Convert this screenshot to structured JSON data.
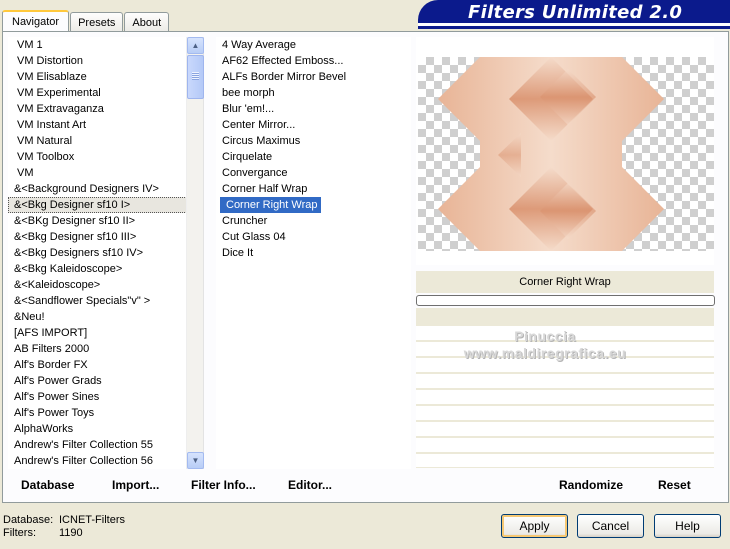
{
  "tabs": [
    "Navigator",
    "Presets",
    "About"
  ],
  "active_tab": "Navigator",
  "banner_title": "Filters Unlimited 2.0",
  "categories": [
    "VM 1",
    "VM Distortion",
    "VM Elisablaze",
    "VM Experimental",
    "VM Extravaganza",
    "VM Instant Art",
    "VM Natural",
    "VM Toolbox",
    "VM",
    "&<Background Designers IV>",
    "&<Bkg Designer sf10 I>",
    "&<BKg Designer sf10 II>",
    "&<Bkg Designer sf10 III>",
    "&<Bkg Designers sf10 IV>",
    "&<Bkg Kaleidoscope>",
    "&<Kaleidoscope>",
    "&<Sandflower Specials\"v\" >",
    "&Neu!",
    "[AFS IMPORT]",
    "AB Filters 2000",
    "Alf's Border FX",
    "Alf's Power Grads",
    "Alf's Power Sines",
    "Alf's Power Toys",
    "AlphaWorks",
    "Andrew's Filter Collection 55",
    "Andrew's Filter Collection 56"
  ],
  "selected_category": "&<Bkg Designer sf10 I>",
  "filters": [
    "4 Way Average",
    "AF62 Effected Emboss...",
    "ALFs Border Mirror Bevel",
    "bee morph",
    "Blur 'em!...",
    "Center Mirror...",
    "Circus Maximus",
    "Cirquelate",
    "Convergance",
    "Corner Half Wrap",
    "Corner Right Wrap",
    "Cruncher",
    "Cut Glass  04",
    "Dice It"
  ],
  "selected_filter": "Corner Right Wrap",
  "preview": {
    "filter_name": "Corner Right Wrap",
    "watermark_line1": "Pinuccia",
    "watermark_line2": "www.maldiregrafica.eu",
    "colors": {
      "light": "#f5dccb",
      "mid": "#e8b496",
      "dark": "#d9906c"
    }
  },
  "bottom_buttons": [
    "Database",
    "Import...",
    "Filter Info...",
    "Editor..."
  ],
  "preview_buttons": [
    "Randomize",
    "Reset"
  ],
  "footer": {
    "database_label": "Database:",
    "database_value": "ICNET-Filters",
    "filters_label": "Filters:",
    "filters_value": "1190"
  },
  "dialog_buttons": {
    "apply": "Apply",
    "cancel": "Cancel",
    "help": "Help"
  }
}
